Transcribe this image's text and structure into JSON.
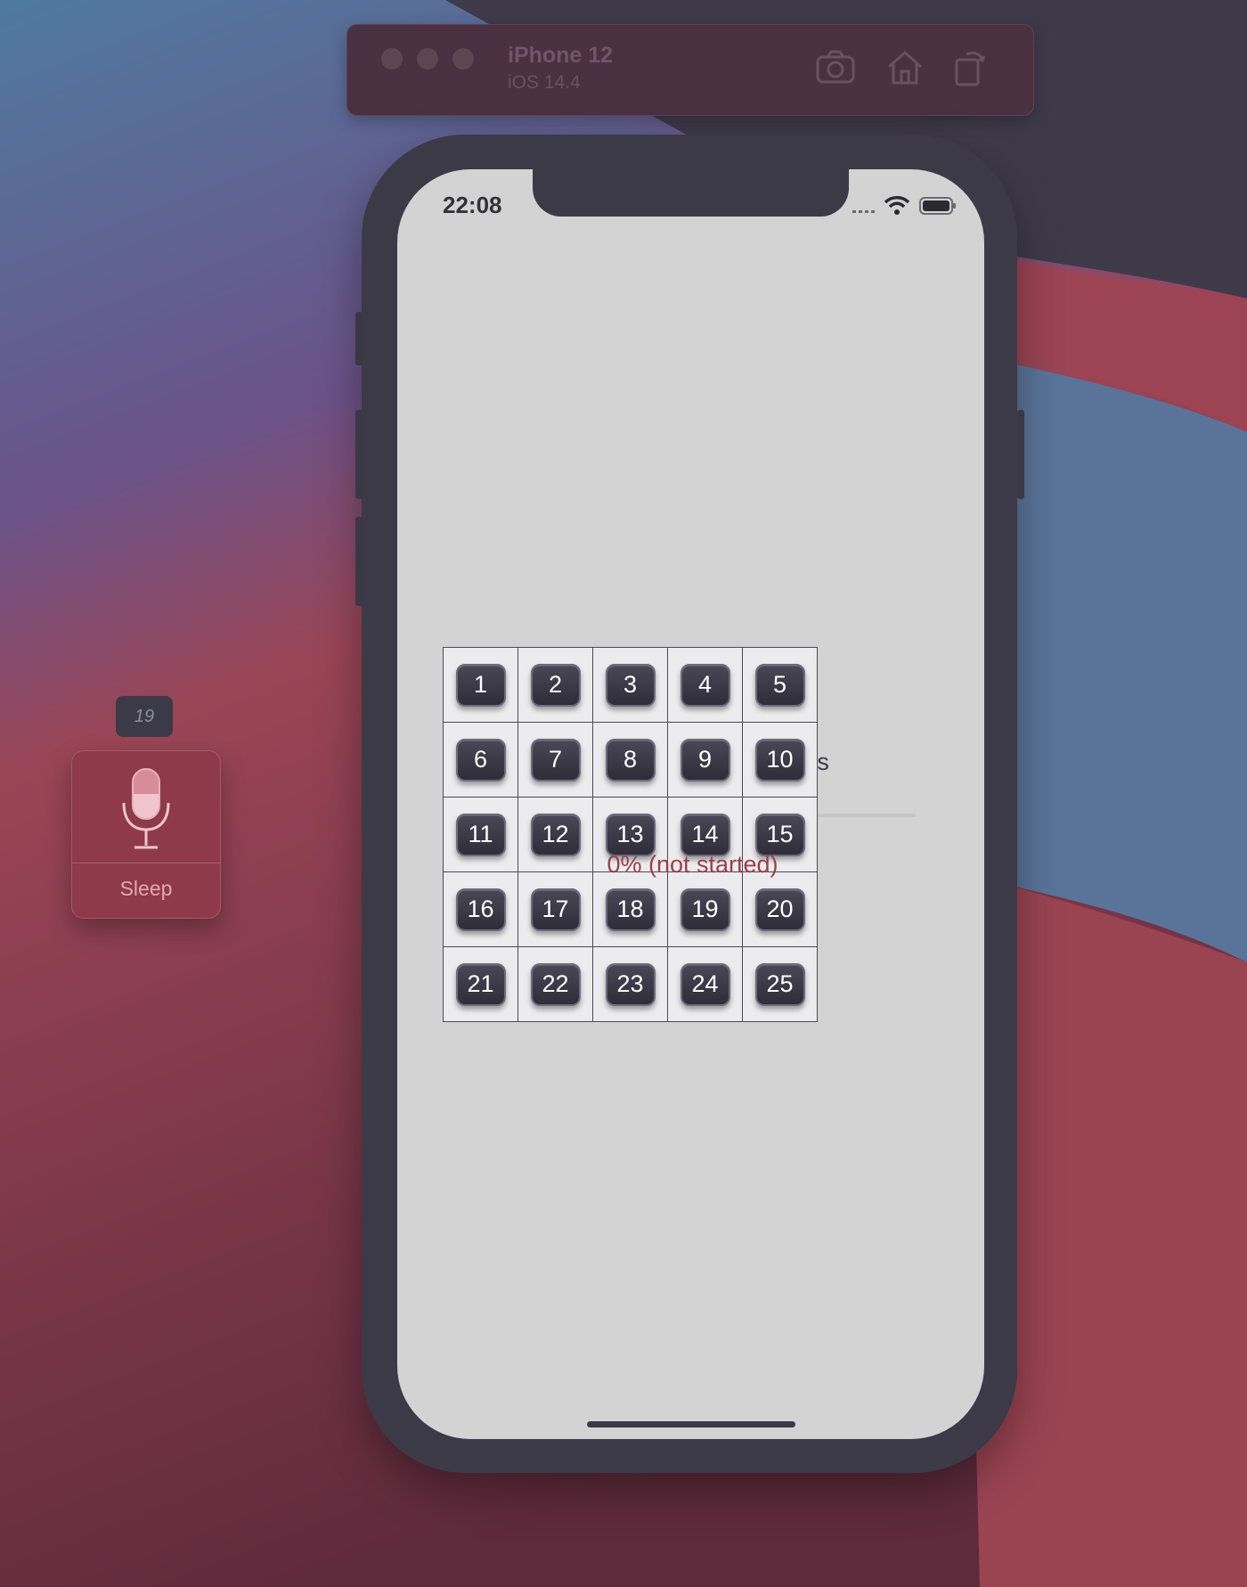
{
  "simulator": {
    "device_name": "iPhone 12",
    "os_version": "iOS 14.4",
    "toolbar_icons": [
      "camera-icon",
      "home-icon",
      "rotate-icon"
    ]
  },
  "status_bar": {
    "time": "22:08",
    "icons": [
      "signal-icon",
      "wifi-icon",
      "battery-icon"
    ]
  },
  "progress": {
    "title": "Lesson's project progress",
    "status": "0% (not started)",
    "fraction": 0.0
  },
  "grid": {
    "labels": [
      "1",
      "2",
      "3",
      "4",
      "5",
      "6",
      "7",
      "8",
      "9",
      "10",
      "11",
      "12",
      "13",
      "14",
      "15",
      "16",
      "17",
      "18",
      "19",
      "20",
      "21",
      "22",
      "23",
      "24",
      "25"
    ]
  },
  "voice_control": {
    "badge_number": "19",
    "label": "Sleep",
    "icon": "microphone-icon"
  },
  "colors": {
    "phone_frame": "#3c3a46",
    "screen_bg": "#d3d3d4",
    "progress_status": "#9a3f4a",
    "voice_panel": "#8e3a4b"
  }
}
